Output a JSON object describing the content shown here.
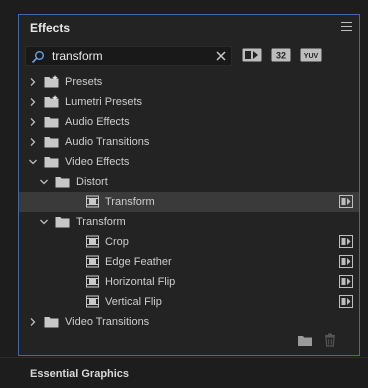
{
  "panel": {
    "title": "Effects"
  },
  "search": {
    "value": "transform"
  },
  "filters": {
    "accelerated_label": "",
    "bit32_label": "32",
    "yuv_label": "YUV"
  },
  "tree": [
    {
      "label": "Presets",
      "expanded": false,
      "level": 0,
      "type": "preset-folder"
    },
    {
      "label": "Lumetri Presets",
      "expanded": false,
      "level": 0,
      "type": "preset-folder"
    },
    {
      "label": "Audio Effects",
      "expanded": false,
      "level": 0,
      "type": "folder"
    },
    {
      "label": "Audio Transitions",
      "expanded": false,
      "level": 0,
      "type": "folder"
    },
    {
      "label": "Video Effects",
      "expanded": true,
      "level": 0,
      "type": "folder"
    },
    {
      "label": "Distort",
      "expanded": true,
      "level": 1,
      "type": "folder"
    },
    {
      "label": "Transform",
      "level": 2,
      "type": "effect",
      "selected": true
    },
    {
      "label": "Transform",
      "expanded": true,
      "level": 1,
      "type": "folder"
    },
    {
      "label": "Crop",
      "level": 2,
      "type": "effect"
    },
    {
      "label": "Edge Feather",
      "level": 2,
      "type": "effect"
    },
    {
      "label": "Horizontal Flip",
      "level": 2,
      "type": "effect"
    },
    {
      "label": "Vertical Flip",
      "level": 2,
      "type": "effect"
    },
    {
      "label": "Video Transitions",
      "expanded": false,
      "level": 0,
      "type": "folder"
    }
  ],
  "next_panel": {
    "title": "Essential Graphics"
  },
  "colors": {
    "panel_border": "#3e6aa8",
    "selected_row": "#3a3a3a",
    "icon": "#c8c8c8"
  }
}
